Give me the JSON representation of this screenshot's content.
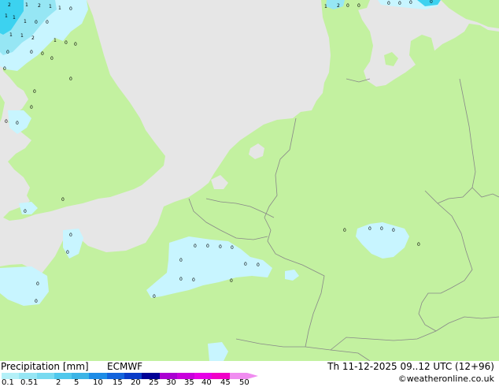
{
  "footer": {
    "title": "Precipitation [mm]",
    "model": "ECMWF",
    "datetime": "Th 11-12-2025 09..12 UTC (12+96)",
    "credit": "©weatheronline.co.uk"
  },
  "legend": {
    "ticks": [
      "0.1",
      "0.5",
      "1",
      "2",
      "5",
      "10",
      "15",
      "20",
      "25",
      "30",
      "35",
      "40",
      "45",
      "50"
    ],
    "colors": [
      "#b4f0f8",
      "#96e6f4",
      "#78daf0",
      "#50c8ec",
      "#3cb4e6",
      "#1e8ce6",
      "#1464dc",
      "#0a3cc8",
      "#000096",
      "#aa00d2",
      "#c800dc",
      "#e600e6",
      "#f000c8",
      "#f08cf0"
    ]
  },
  "map": {
    "colors": {
      "sea": "#e6e6e6",
      "land": "#c3f1a0",
      "border": "#888888",
      "precip_light": "#c8f5ff",
      "precip_medium": "#96e6f4",
      "precip_heavy": "#3cd2f0"
    },
    "precip_labels": [
      "2",
      "1",
      "2",
      "1",
      "1",
      "0",
      "1",
      "1",
      "1",
      "0",
      "0",
      "1",
      "1",
      "2",
      "1",
      "0",
      "0",
      "0",
      "0",
      "0",
      "0",
      "0",
      "1",
      "2",
      "0",
      "0",
      "0",
      "0",
      "0",
      "0",
      "0",
      "0",
      "0",
      "0",
      "0",
      "0",
      "0",
      "0",
      "0",
      "0",
      "0",
      "0",
      "0",
      "0",
      "0",
      "0",
      "0",
      "0",
      "0",
      "0",
      "0",
      "0",
      "0",
      "0",
      "0",
      "0",
      "0"
    ]
  }
}
